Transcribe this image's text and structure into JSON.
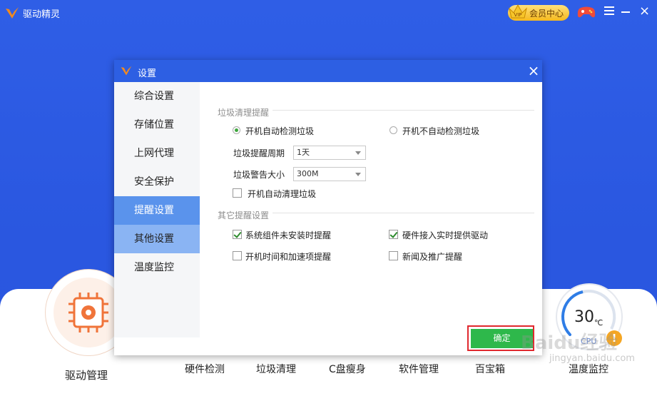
{
  "app": {
    "title": "驱动精灵",
    "vip_label": "会员中心",
    "vip_badge": "VIP"
  },
  "bottom_nav": {
    "driver_manage": "驱动管理",
    "items": [
      "硬件检测",
      "垃圾清理",
      "C盘瘦身",
      "软件管理",
      "百宝箱",
      "温度监控"
    ],
    "temp_value": "30",
    "temp_unit": "℃",
    "cpu_label": "CPU",
    "warn": "!"
  },
  "dialog": {
    "title": "设置",
    "sidebar": [
      "综合设置",
      "存储位置",
      "上网代理",
      "安全保护",
      "提醒设置",
      "其他设置",
      "温度监控"
    ],
    "active_index": 4,
    "junk_section": {
      "title": "垃圾清理提醒",
      "radio_on": "开机自动检测垃圾",
      "radio_off": "开机不自动检测垃圾",
      "period_label": "垃圾提醒周期",
      "period_value": "1天",
      "size_label": "垃圾警告大小",
      "size_value": "300M",
      "auto_clean": "开机自动清理垃圾",
      "auto_clean_checked": false
    },
    "other_section": {
      "title": "其它提醒设置",
      "options": [
        {
          "label": "系统组件未安装时提醒",
          "checked": true
        },
        {
          "label": "硬件接入实时提供驱动",
          "checked": true
        },
        {
          "label": "开机时间和加速项提醒",
          "checked": false
        },
        {
          "label": "新闻及推广提醒",
          "checked": false
        }
      ]
    },
    "confirm": "确定"
  },
  "watermark": {
    "text": "Baidu经验",
    "sub": "jingyan.baidu.com"
  }
}
